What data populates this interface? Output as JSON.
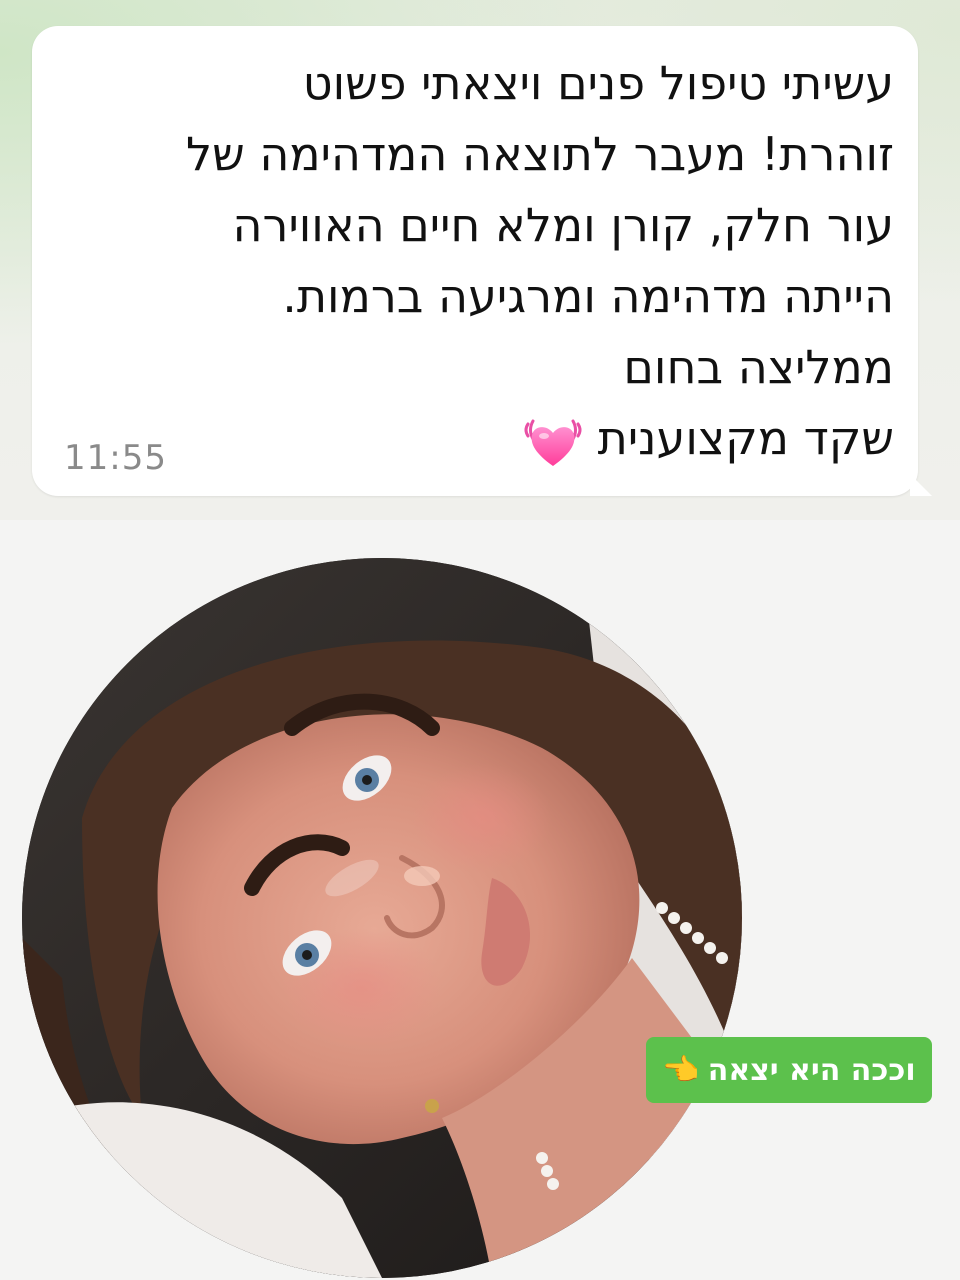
{
  "message": {
    "lines": [
      "עשיתי טיפול פנים ויצאתי פשוט",
      "זוהרת! מעבר לתוצאה המדהימה של",
      "עור חלק, קורן ומלא חיים האווירה",
      "הייתה מדהימה ומרגיעה ברמות.",
      "ממליצה בחום",
      "שקד מקצוענית"
    ],
    "emoji": "beating-heart-icon",
    "time": "11:55"
  },
  "badge": {
    "label": "וככה היא יצאה",
    "icon": "pointing-hand-icon",
    "color": "#5cc14c"
  },
  "colors": {
    "bubble": "#ffffff",
    "text": "#111111",
    "timestamp": "#8a8a8a"
  }
}
